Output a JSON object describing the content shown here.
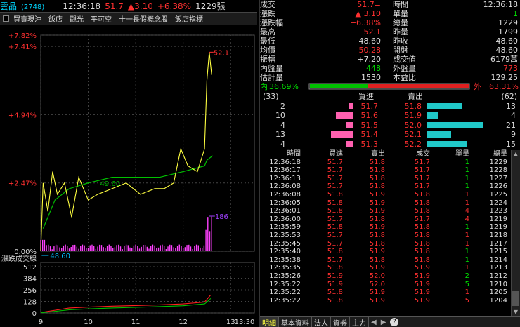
{
  "title_bar": {
    "stock_name": "雲品",
    "stock_code": "(2748)",
    "time": "12:36:18",
    "price": "51.7",
    "change": "▲3.10",
    "change_pct": "+6.38%",
    "volume": "1229張"
  },
  "toolbar": {
    "items": [
      "買賣現沖",
      "飯店",
      "觀光",
      "平可空",
      "十一長假概念股",
      "飯店指標"
    ]
  },
  "chart": {
    "y_labels_top": [
      "+7.82%",
      "+7.41%",
      "+4.94%",
      "+2.47%",
      "0.00%"
    ],
    "annot_high": "52.1",
    "annot_low": "48.60",
    "annot_vol": "186",
    "avg_label": "49.60",
    "volume_panel_title": "漲跌成交線",
    "vol_y_labels": [
      "512",
      "384",
      "256",
      "128",
      "0"
    ],
    "x_labels": [
      "9",
      "10",
      "11",
      "12",
      "13",
      "13:30"
    ],
    "colors": {
      "price_line": "#ffff40",
      "avg_line": "#00c000",
      "volume_bar": "#ff40ff",
      "grid": "#444444",
      "red_line": "#ff2020",
      "green_line": "#00c000"
    }
  },
  "chart_data": {
    "type": "line",
    "title": "",
    "x_ticks": [
      "9",
      "10",
      "11",
      "12",
      "13",
      "13:30"
    ],
    "y_range": [
      48.6,
      52.1
    ],
    "reference_price": 48.6,
    "price_series": [
      {
        "t": 9.0,
        "v": 48.6
      },
      {
        "t": 9.05,
        "v": 49.8
      },
      {
        "t": 9.15,
        "v": 49.3
      },
      {
        "t": 9.25,
        "v": 50.0
      },
      {
        "t": 9.35,
        "v": 49.6
      },
      {
        "t": 9.5,
        "v": 49.8
      },
      {
        "t": 9.65,
        "v": 49.2
      },
      {
        "t": 9.8,
        "v": 49.9
      },
      {
        "t": 10.0,
        "v": 49.5
      },
      {
        "t": 10.2,
        "v": 49.6
      },
      {
        "t": 10.5,
        "v": 49.7
      },
      {
        "t": 10.8,
        "v": 49.8
      },
      {
        "t": 11.1,
        "v": 49.6
      },
      {
        "t": 11.4,
        "v": 49.7
      },
      {
        "t": 11.6,
        "v": 49.7
      },
      {
        "t": 11.8,
        "v": 49.8
      },
      {
        "t": 11.95,
        "v": 50.4
      },
      {
        "t": 12.1,
        "v": 50.1
      },
      {
        "t": 12.3,
        "v": 50.0
      },
      {
        "t": 12.45,
        "v": 50.4
      },
      {
        "t": 12.5,
        "v": 51.6
      },
      {
        "t": 12.55,
        "v": 52.1
      },
      {
        "t": 12.6,
        "v": 51.7
      }
    ],
    "avg_series_label": "均價",
    "high": 52.1,
    "low": 48.6,
    "max_volume": 186
  },
  "info_panel": {
    "left": [
      {
        "label": "成交",
        "value": "51.7=",
        "color": "red"
      },
      {
        "label": "漲跌",
        "value": "▲ 3.10",
        "color": "red"
      },
      {
        "label": "漲跌幅",
        "value": "+6.38%",
        "color": "red"
      },
      {
        "label": "最高",
        "value": "52.1",
        "color": "red"
      },
      {
        "label": "最低",
        "value": "48.60",
        "color": "white"
      },
      {
        "label": "均價",
        "value": "50.28",
        "color": "red"
      },
      {
        "label": "振幅",
        "value": "+7.20",
        "color": "white"
      },
      {
        "label": "內盤量",
        "value": "448",
        "color": "green"
      },
      {
        "label": "估計量",
        "value": "1530",
        "color": "white"
      }
    ],
    "right": [
      {
        "label": "時間",
        "value": "12:36:18",
        "color": "white"
      },
      {
        "label": "單量",
        "value": "1",
        "color": "green"
      },
      {
        "label": "總量",
        "value": "1229",
        "color": "white"
      },
      {
        "label": "昨量",
        "value": "1799",
        "color": "white"
      },
      {
        "label": "昨收",
        "value": "48.60",
        "color": "white"
      },
      {
        "label": "開盤",
        "value": "48.60",
        "color": "white"
      },
      {
        "label": "成交值",
        "value": "6179萬",
        "color": "white"
      },
      {
        "label": "外盤量",
        "value": "773",
        "color": "red"
      },
      {
        "label": "本益比",
        "value": "129.25",
        "color": "white"
      }
    ]
  },
  "ratio": {
    "in_label": "內",
    "in_pct": "36.69%",
    "out_label": "外",
    "out_pct": "63.31%",
    "in_fraction": 0.3669
  },
  "orderbook": {
    "bid_total": "(33)",
    "ask_total": "(62)",
    "bid_header": "買進",
    "ask_header": "賣出",
    "rows": [
      {
        "bid_qty": "2",
        "bid": "51.7",
        "ask": "51.8",
        "ask_qty": "13",
        "bid_frac": 0.1,
        "ask_frac": 0.62
      },
      {
        "bid_qty": "10",
        "bid": "51.6",
        "ask": "51.9",
        "ask_qty": "4",
        "bid_frac": 0.48,
        "ask_frac": 0.19
      },
      {
        "bid_qty": "4",
        "bid": "51.5",
        "ask": "52.0",
        "ask_qty": "21",
        "bid_frac": 0.19,
        "ask_frac": 1.0
      },
      {
        "bid_qty": "13",
        "bid": "51.4",
        "ask": "52.1",
        "ask_qty": "9",
        "bid_frac": 0.62,
        "ask_frac": 0.43
      },
      {
        "bid_qty": "4",
        "bid": "51.3",
        "ask": "52.2",
        "ask_qty": "15",
        "bid_frac": 0.19,
        "ask_frac": 0.71
      }
    ]
  },
  "trades": {
    "headers": [
      "時間",
      "買進",
      "賣出",
      "成交",
      "單量",
      "總量"
    ],
    "rows": [
      [
        "12:36:18",
        "51.7",
        "51.8",
        "51.7",
        "1",
        "1229"
      ],
      [
        "12:36:17",
        "51.7",
        "51.8",
        "51.7",
        "1",
        "1228"
      ],
      [
        "12:36:13",
        "51.7",
        "51.8",
        "51.7",
        "1",
        "1227"
      ],
      [
        "12:36:08",
        "51.7",
        "51.8",
        "51.7",
        "1",
        "1226"
      ],
      [
        "12:36:08",
        "51.8",
        "51.9",
        "51.8",
        "1",
        "1225"
      ],
      [
        "12:36:05",
        "51.8",
        "51.9",
        "51.8",
        "1",
        "1224"
      ],
      [
        "12:36:01",
        "51.8",
        "51.9",
        "51.8",
        "4",
        "1223"
      ],
      [
        "12:36:00",
        "51.7",
        "51.8",
        "51.7",
        "4",
        "1219"
      ],
      [
        "12:35:59",
        "51.8",
        "51.9",
        "51.8",
        "1",
        "1219"
      ],
      [
        "12:35:53",
        "51.7",
        "51.8",
        "51.8",
        "1",
        "1218"
      ],
      [
        "12:35:45",
        "51.7",
        "51.8",
        "51.8",
        "1",
        "1217"
      ],
      [
        "12:35:40",
        "51.8",
        "51.9",
        "51.8",
        "1",
        "1215"
      ],
      [
        "12:35:38",
        "51.7",
        "51.8",
        "51.8",
        "1",
        "1214"
      ],
      [
        "12:35:35",
        "51.8",
        "51.9",
        "51.9",
        "1",
        "1213"
      ],
      [
        "12:35:26",
        "51.9",
        "52.0",
        "51.9",
        "2",
        "1212"
      ],
      [
        "12:35:22",
        "51.9",
        "52.0",
        "51.9",
        "5",
        "1210"
      ],
      [
        "12:35:22",
        "51.8",
        "51.9",
        "51.9",
        "1",
        "1205"
      ],
      [
        "12:35:22",
        "51.8",
        "51.9",
        "51.9",
        "5",
        "1204"
      ]
    ],
    "row_colors": [
      [
        "white",
        "red",
        "red",
        "red",
        "green",
        "white"
      ],
      [
        "white",
        "red",
        "red",
        "red",
        "green",
        "white"
      ],
      [
        "white",
        "red",
        "red",
        "red",
        "green",
        "white"
      ],
      [
        "white",
        "red",
        "red",
        "red",
        "green",
        "white"
      ],
      [
        "white",
        "red",
        "red",
        "red",
        "red",
        "white"
      ],
      [
        "white",
        "red",
        "red",
        "red",
        "red",
        "white"
      ],
      [
        "white",
        "red",
        "red",
        "red",
        "red",
        "white"
      ],
      [
        "white",
        "red",
        "red",
        "red",
        "red",
        "white"
      ],
      [
        "white",
        "red",
        "red",
        "red",
        "green",
        "white"
      ],
      [
        "white",
        "red",
        "red",
        "red",
        "red",
        "white"
      ],
      [
        "white",
        "red",
        "red",
        "red",
        "red",
        "white"
      ],
      [
        "white",
        "red",
        "red",
        "red",
        "green",
        "white"
      ],
      [
        "white",
        "red",
        "red",
        "red",
        "green",
        "white"
      ],
      [
        "white",
        "red",
        "red",
        "red",
        "red",
        "white"
      ],
      [
        "white",
        "red",
        "red",
        "red",
        "green",
        "white"
      ],
      [
        "white",
        "red",
        "red",
        "red",
        "green",
        "white"
      ],
      [
        "white",
        "red",
        "red",
        "red",
        "red",
        "white"
      ],
      [
        "white",
        "red",
        "red",
        "red",
        "red",
        "white"
      ]
    ]
  },
  "tabs": {
    "items": [
      "明細",
      "基本資料",
      "法人",
      "資券",
      "主力"
    ],
    "active_index": 0,
    "help": "?"
  }
}
